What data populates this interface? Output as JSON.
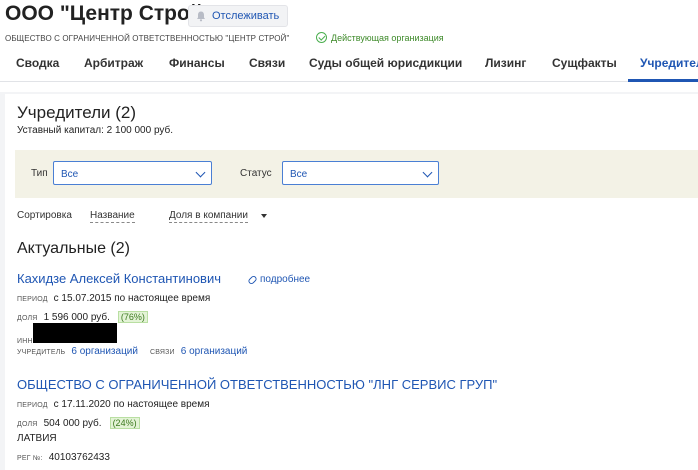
{
  "header": {
    "company_name": "ООО \"Центр Строй\"",
    "follow_label": "Отслеживать",
    "full_name": "ОБЩЕСТВО С ОГРАНИЧЕННОЙ ОТВЕТСТВЕННОСТЬЮ \"ЦЕНТР СТРОЙ\"",
    "status": "Действующая организация"
  },
  "tabs": [
    {
      "label": "Сводка"
    },
    {
      "label": "Арбитраж"
    },
    {
      "label": "Финансы"
    },
    {
      "label": "Связи"
    },
    {
      "label": "Суды общей юрисдикции"
    },
    {
      "label": "Лизинг"
    },
    {
      "label": "Сущфакты"
    },
    {
      "label": "Учредители"
    }
  ],
  "main": {
    "title": "Учредители (2)",
    "capital": "Уставный капитал: 2 100 000 руб.",
    "filters": {
      "type_label": "Тип",
      "type_value": "Все",
      "status_label": "Статус",
      "status_value": "Все"
    },
    "sort": {
      "label": "Сортировка",
      "option1": "Название",
      "option2": "Доля в компании"
    },
    "section_title": "Актуальные (2)"
  },
  "founders": [
    {
      "name": "Кахидзе Алексей Константинович",
      "more": "подробнее",
      "period_label": "ПЕРИОД",
      "period": "с 15.07.2015 по настоящее время",
      "share_label": "ДОЛЯ",
      "share": "1 596 000 руб.",
      "percent": "(76%)",
      "inn_label": "ИНН",
      "founder_label": "УЧРЕДИТЕЛЬ",
      "founder_value": "6 организаций",
      "links_label": "СВЯЗИ",
      "links_value": "6 организаций"
    },
    {
      "name": "ОБЩЕСТВО С ОГРАНИЧЕННОЙ ОТВЕТСТВЕННОСТЬЮ \"ЛНГ СЕРВИС ГРУП\"",
      "period_label": "ПЕРИОД",
      "period": "с 17.11.2020 по настоящее время",
      "share_label": "ДОЛЯ",
      "share": "504 000 руб.",
      "percent": "(24%)",
      "country": "ЛАТВИЯ",
      "reg_label": "РЕГ №:",
      "reg_value": "40103762433"
    }
  ]
}
